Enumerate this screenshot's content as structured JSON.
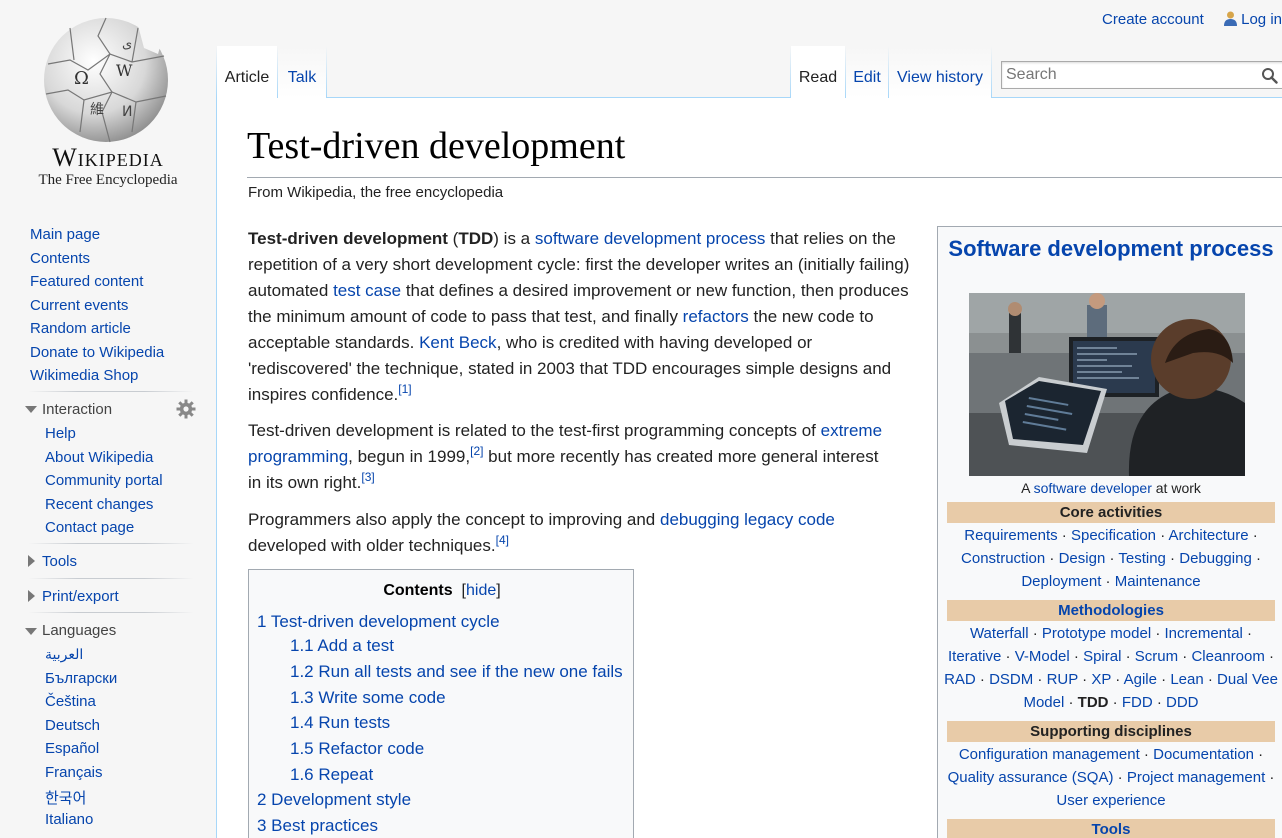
{
  "site": {
    "wordmark": "Wikipedia",
    "tagline": "The Free Encyclopedia"
  },
  "personal": {
    "create_account": "Create account",
    "log_in": "Log in"
  },
  "tabs": {
    "article": "Article",
    "talk": "Talk",
    "read": "Read",
    "edit": "Edit",
    "view_history": "View history"
  },
  "search": {
    "placeholder": "Search"
  },
  "sidebar": {
    "nav": [
      "Main page",
      "Contents",
      "Featured content",
      "Current events",
      "Random article",
      "Donate to Wikipedia",
      "Wikimedia Shop"
    ],
    "interaction_heading": "Interaction",
    "interaction": [
      "Help",
      "About Wikipedia",
      "Community portal",
      "Recent changes",
      "Contact page"
    ],
    "tools_heading": "Tools",
    "print_heading": "Print/export",
    "languages_heading": "Languages",
    "languages": [
      "العربية",
      "Български",
      "Čeština",
      "Deutsch",
      "Español",
      "Français",
      "한국어",
      "Italiano"
    ]
  },
  "article": {
    "title": "Test-driven development",
    "from": "From Wikipedia, the free encyclopedia",
    "p1": {
      "t_bold1": "Test-driven development",
      "t_a": " (",
      "t_bold2": "TDD",
      "t_b": ") is a ",
      "l1": "software development process",
      "t_c": " that relies on the repetition of a very short development cycle: first the developer writes an (initially failing) automated ",
      "l2": "test case",
      "t_d": " that defines a desired improvement or new function, then produces the minimum amount of code to pass that test, and finally ",
      "l3": "refactors",
      "t_e": " the new code to acceptable standards. ",
      "l4": "Kent Beck",
      "t_f": ", who is credited with having developed or 'rediscovered' the technique, stated in 2003 that TDD encourages simple designs and inspires confidence.",
      "ref": "[1]"
    },
    "p2": {
      "t_a": "Test-driven development is related to the test-first programming concepts of ",
      "l1": "extreme programming",
      "t_b": ", begun in 1999,",
      "ref1": "[2]",
      "t_c": " but more recently has created more general interest in its own right.",
      "ref2": "[3]"
    },
    "p3": {
      "t_a": "Programmers also apply the concept to improving and ",
      "l1": "debugging legacy code",
      "t_b": " developed with older techniques.",
      "ref": "[4]"
    }
  },
  "toc": {
    "title": "Contents",
    "hide": "hide",
    "open_bracket": "[",
    "close_bracket": "]",
    "items": [
      "1 Test-driven development cycle",
      "1.1 Add a test",
      "1.2 Run all tests and see if the new one fails",
      "1.3 Write some code",
      "1.4 Run tests",
      "1.5 Refactor code",
      "1.6 Repeat",
      "2 Development style",
      "3 Best practices"
    ]
  },
  "infobox": {
    "title": "Software development process",
    "caption_pre": "A ",
    "caption_link": "software developer",
    "caption_post": " at work",
    "sep": " · ",
    "core_heading": "Core activities",
    "core": [
      "Requirements",
      "Specification",
      "Architecture",
      "Construction",
      "Design",
      "Testing",
      "Debugging",
      "Deployment",
      "Maintenance"
    ],
    "methodologies_heading": "Methodologies",
    "methodologies": [
      "Waterfall",
      "Prototype model",
      "Incremental",
      "Iterative",
      "V-Model",
      "Spiral",
      "Scrum",
      "Cleanroom",
      "RAD",
      "DSDM",
      "RUP",
      "XP",
      "Agile",
      "Lean",
      "Dual Vee Model",
      "TDD",
      "FDD",
      "DDD"
    ],
    "supporting_heading": "Supporting disciplines",
    "supporting": [
      "Configuration management",
      "Documentation",
      "Quality assurance (SQA)",
      "Project management",
      "User experience"
    ],
    "tools_heading": "Tools"
  },
  "colors": {
    "link": "#0645ad",
    "infobox_header": "#e8cba8",
    "border_blue": "#a7d7f9"
  }
}
